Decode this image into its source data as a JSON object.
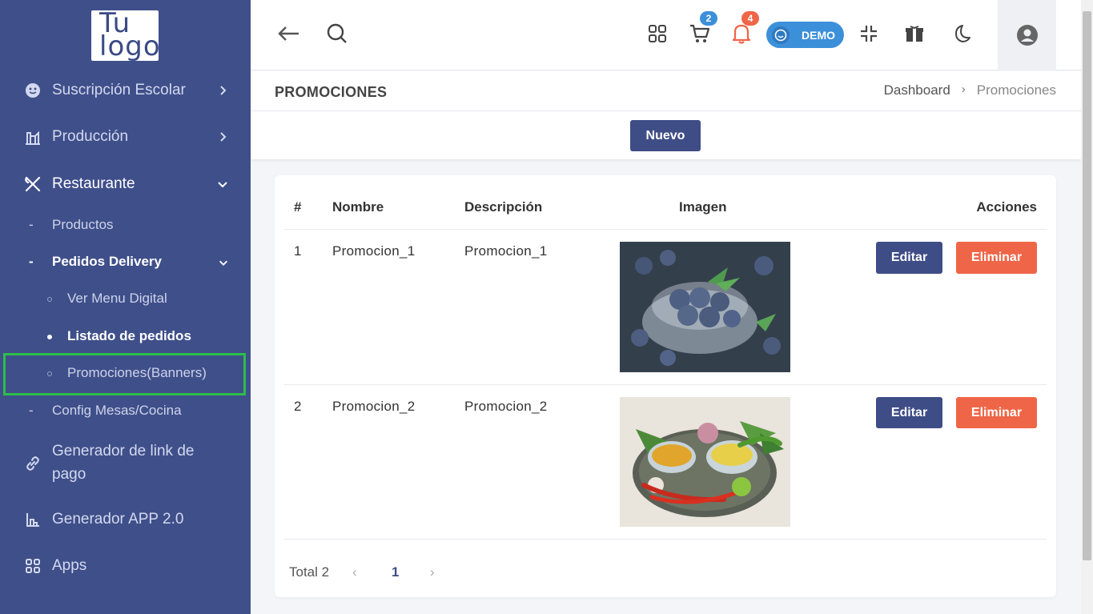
{
  "logo": {
    "line1": "Tu",
    "line2": "logo"
  },
  "sidebar": {
    "items": [
      {
        "label": "Suscripción Escolar",
        "icon": "face-icon"
      },
      {
        "label": "Producción",
        "icon": "factory-icon"
      },
      {
        "label": "Restaurante",
        "icon": "utensils-icon"
      },
      {
        "label": "Generador de link de pago",
        "icon": "link-icon"
      },
      {
        "label": "Generador APP 2.0",
        "icon": "app-builder-icon"
      },
      {
        "label": "Apps",
        "icon": "apps-icon"
      }
    ],
    "restaurant_sub": [
      {
        "label": "Productos"
      },
      {
        "label": "Pedidos Delivery"
      },
      {
        "label": "Config Mesas/Cocina"
      }
    ],
    "delivery_sub": [
      {
        "label": "Ver Menu Digital"
      },
      {
        "label": "Listado de pedidos"
      },
      {
        "label": "Promociones(Banners)"
      }
    ]
  },
  "topbar": {
    "cart_count": "2",
    "notif_count": "4",
    "demo_label": "DEMO"
  },
  "page": {
    "title": "PROMOCIONES",
    "breadcrumb": [
      "Dashboard",
      "Promociones"
    ],
    "new_button": "Nuevo"
  },
  "table": {
    "headers": [
      "#",
      "Nombre",
      "Descripción",
      "Imagen",
      "Acciones"
    ],
    "rows": [
      {
        "num": "1",
        "nombre": "Promocion_1",
        "descripcion": "Promocion_1",
        "image": "blueberries-image",
        "edit": "Editar",
        "delete": "Eliminar"
      },
      {
        "num": "2",
        "nombre": "Promocion_2",
        "descripcion": "Promocion_2",
        "image": "spices-plate-image",
        "edit": "Editar",
        "delete": "Eliminar"
      }
    ]
  },
  "pagination": {
    "total": "Total 2",
    "current_page": "1"
  },
  "colors": {
    "sidebar": "#3f4f8a",
    "primary": "#3f4d86",
    "danger": "#ef6547",
    "demo": "#3c8fd9",
    "highlight": "#2dbd4a"
  }
}
